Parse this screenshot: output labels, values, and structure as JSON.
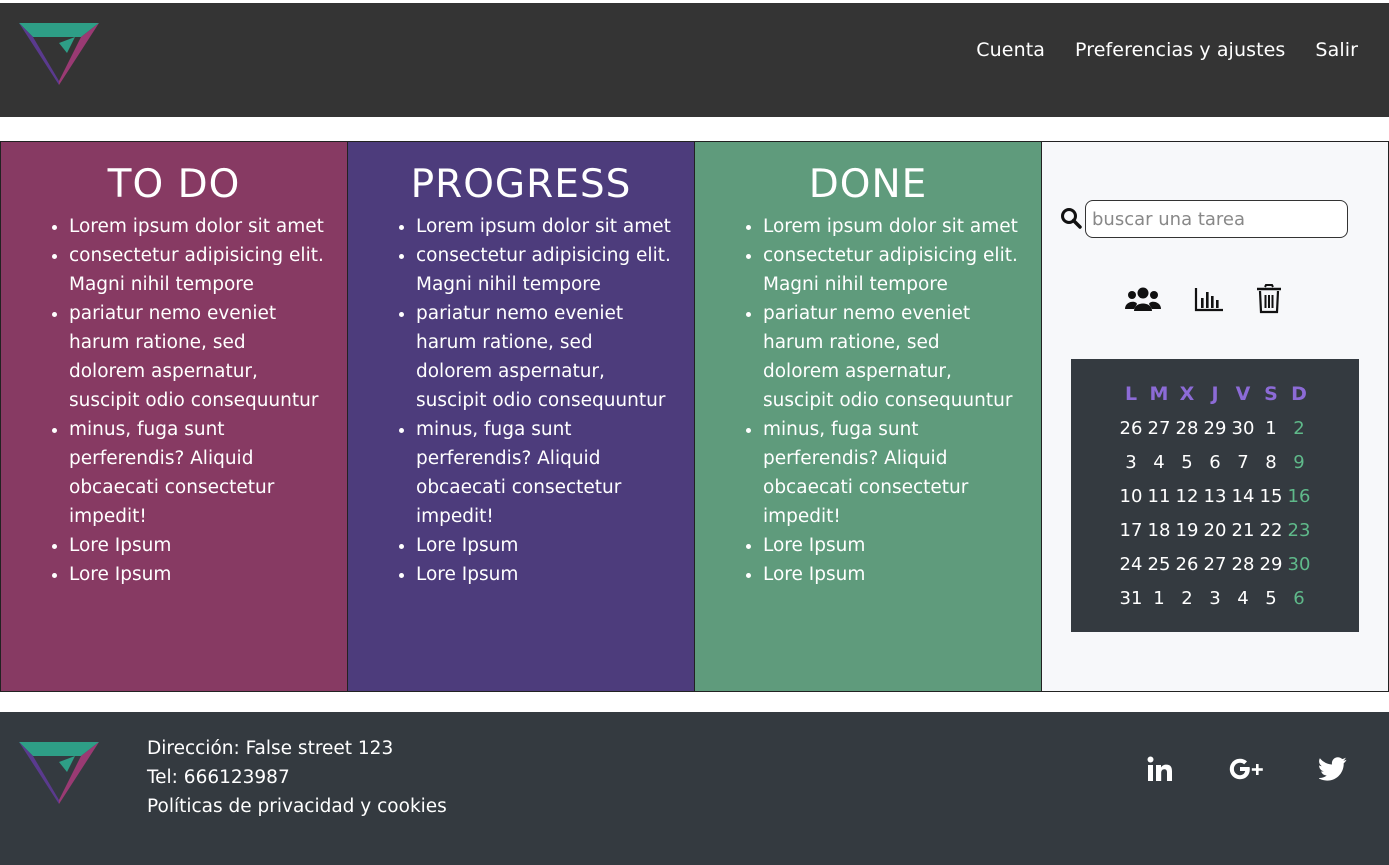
{
  "nav": [
    "Cuenta",
    "Preferencias y ajustes",
    "Salir"
  ],
  "columns": {
    "todo": {
      "title": "TO DO",
      "items": [
        "Lorem ipsum dolor sit amet",
        "consectetur adipisicing elit. Magni nihil tempore",
        "pariatur nemo eveniet harum ratione, sed dolorem aspernatur, suscipit odio consequuntur",
        "minus, fuga sunt perferendis? Aliquid obcaecati consectetur impedit!",
        "Lore Ipsum",
        "Lore Ipsum"
      ]
    },
    "progress": {
      "title": "PROGRESS",
      "items": [
        "Lorem ipsum dolor sit amet",
        "consectetur adipisicing elit. Magni nihil tempore",
        "pariatur nemo eveniet harum ratione, sed dolorem aspernatur, suscipit odio consequuntur",
        "minus, fuga sunt perferendis? Aliquid obcaecati consectetur impedit!",
        "Lore Ipsum",
        "Lore Ipsum"
      ]
    },
    "done": {
      "title": "DONE",
      "items": [
        "Lorem ipsum dolor sit amet",
        "consectetur adipisicing elit. Magni nihil tempore",
        "pariatur nemo eveniet harum ratione, sed dolorem aspernatur, suscipit odio consequuntur",
        "minus, fuga sunt perferendis? Aliquid obcaecati consectetur impedit!",
        "Lore Ipsum",
        "Lore Ipsum"
      ]
    }
  },
  "search": {
    "placeholder": "buscar una tarea"
  },
  "tools": [
    "users-icon",
    "bar-chart-icon",
    "trash-icon"
  ],
  "calendar": {
    "headers": [
      "L",
      "M",
      "X",
      "J",
      "V",
      "S",
      "D"
    ],
    "weeks": [
      [
        "26",
        "27",
        "28",
        "29",
        "30",
        "1",
        "2"
      ],
      [
        "3",
        "4",
        "5",
        "6",
        "7",
        "8",
        "9"
      ],
      [
        "10",
        "11",
        "12",
        "13",
        "14",
        "15",
        "16"
      ],
      [
        "17",
        "18",
        "19",
        "20",
        "21",
        "22",
        "23"
      ],
      [
        "24",
        "25",
        "26",
        "27",
        "28",
        "29",
        "30"
      ],
      [
        "31",
        "1",
        "2",
        "3",
        "4",
        "5",
        "6"
      ]
    ]
  },
  "footer": {
    "address": "Dirección: False street 123",
    "phone": "Tel: 666123987",
    "privacy": "Políticas de privacidad y cookies"
  },
  "social": [
    "linkedin-icon",
    "google-plus-icon",
    "twitter-icon"
  ],
  "colors": {
    "header_bg": "#343434",
    "todo": "#873a63",
    "progress": "#4d3c7c",
    "done": "#5f9b7c",
    "calendar_bg": "#343a40",
    "calendar_header": "#8c6bd6",
    "calendar_sunday": "#5fb98a",
    "footer_bg": "#343a40"
  }
}
